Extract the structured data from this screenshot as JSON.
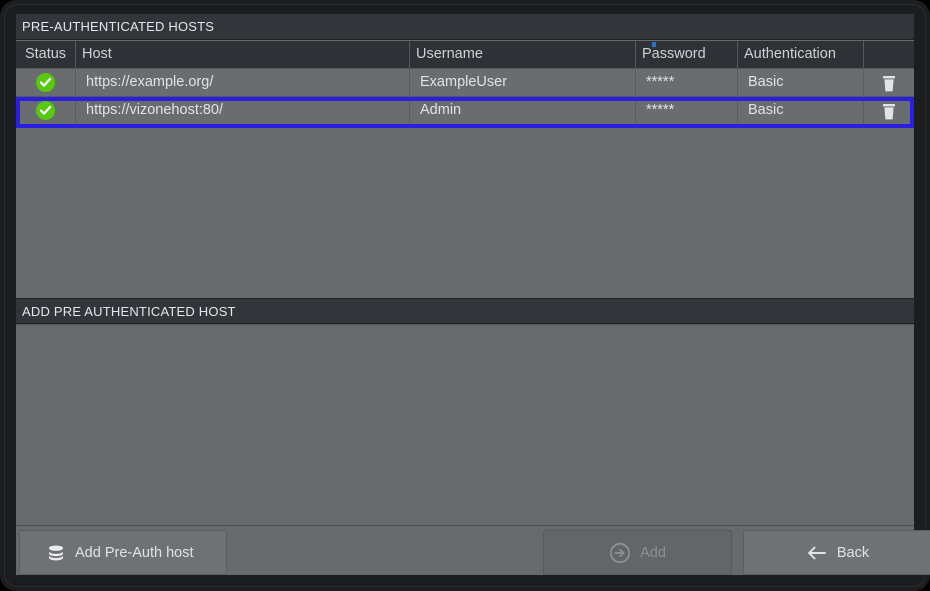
{
  "sections": {
    "hosts": {
      "title": "PRE-AUTHENTICATED HOSTS"
    },
    "add_host": {
      "title": "ADD PRE AUTHENTICATED HOST"
    }
  },
  "table": {
    "columns": [
      {
        "key": "status",
        "label": "Status"
      },
      {
        "key": "host",
        "label": "Host"
      },
      {
        "key": "username",
        "label": "Username"
      },
      {
        "key": "password",
        "label": "Password"
      },
      {
        "key": "authentication",
        "label": "Authentication"
      },
      {
        "key": "actions",
        "label": ""
      }
    ],
    "rows": [
      {
        "status": "ok",
        "status_icon": "check-circle-icon",
        "host": "https://example.org/",
        "username": "ExampleUser",
        "password": "*****",
        "authentication": "Basic",
        "delete_icon": "trash-icon",
        "selected": false
      },
      {
        "status": "ok",
        "status_icon": "check-circle-icon",
        "host": "https://vizonehost:80/",
        "username": "Admin",
        "password": "*****",
        "authentication": "Basic",
        "delete_icon": "trash-icon",
        "selected": true
      }
    ]
  },
  "footer": {
    "add_preauth": {
      "label": "Add Pre-Auth host",
      "icon": "database-icon",
      "enabled": true
    },
    "add": {
      "label": "Add",
      "icon": "arrow-right-circle-icon",
      "enabled": false
    },
    "back": {
      "label": "Back",
      "icon": "arrow-left-icon",
      "enabled": true
    }
  },
  "colors": {
    "window_frame": "#1b1d1f",
    "panel_background": "#67696c",
    "section_header": "#32363a",
    "table_header": "#2e3135",
    "row_background": "#6a6d70",
    "selection_border": "#2a1fe0",
    "status_ok": "#57c90f",
    "text_primary": "#dfe3e7",
    "text_disabled": "#8d9093",
    "button_face": "#6f7275"
  }
}
